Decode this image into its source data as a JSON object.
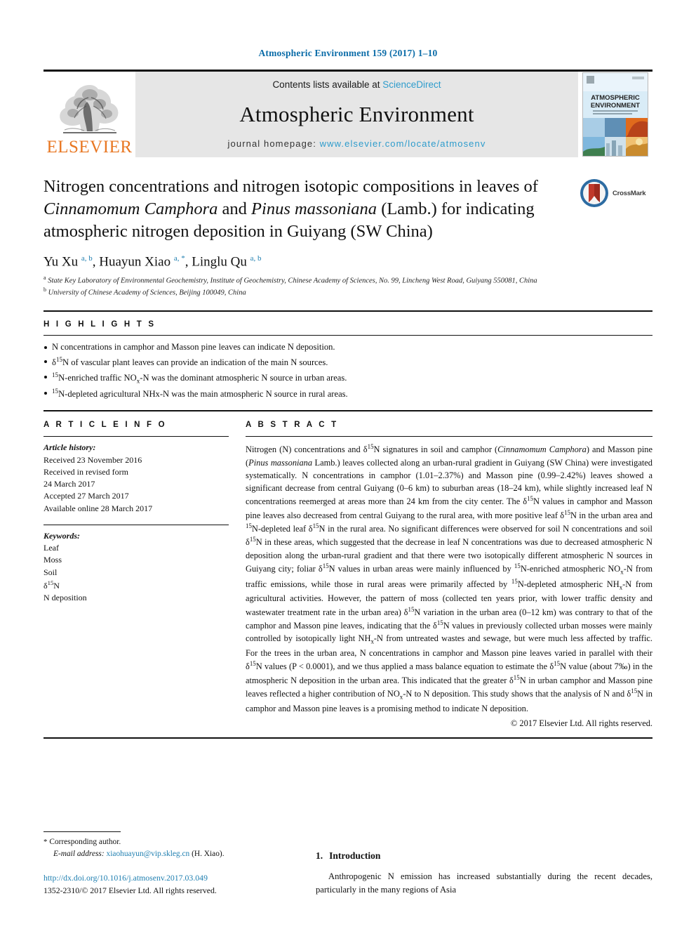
{
  "running_head": "Atmospheric Environment 159 (2017) 1–10",
  "banner": {
    "publisher_name": "ELSEVIER",
    "contents_prefix": "Contents lists available at ",
    "sciencedirect": "ScienceDirect",
    "journal_title": "Atmospheric Environment",
    "homepage_label": "journal homepage: ",
    "homepage_url": "www.elsevier.com/locate/atmosenv",
    "cover_title_line1": "ATMOSPHERIC",
    "cover_title_line2": "ENVIRONMENT"
  },
  "article": {
    "title_part1": "Nitrogen concentrations and nitrogen isotopic compositions in leaves of ",
    "title_italic1": "Cinnamomum Camphora",
    "title_part2": " and ",
    "title_italic2": "Pinus massoniana",
    "title_part3": " (Lamb.) for indicating atmospheric nitrogen deposition in Guiyang (SW China)",
    "crossmark_label": "CrossMark",
    "authors_plain": "Yu Xu a, b, Huayun Xiao a, *, Linglu Qu a, b",
    "affiliation_a": "State Key Laboratory of Environmental Geochemistry, Institute of Geochemistry, Chinese Academy of Sciences, No. 99, Lincheng West Road, Guiyang 550081, China",
    "affiliation_b": "University of Chinese Academy of Sciences, Beijing 100049, China"
  },
  "highlights": {
    "heading": "H I G H L I G H T S",
    "items": [
      "N concentrations in camphor and Masson pine leaves can indicate N deposition.",
      "δ15N of vascular plant leaves can provide an indication of the main N sources.",
      "15N-enriched traffic NOx-N was the dominant atmospheric N source in urban areas.",
      "15N-depleted agricultural NHx-N was the main atmospheric N source in rural areas."
    ]
  },
  "article_info": {
    "heading": "A R T I C L E   I N F O",
    "history_label": "Article history:",
    "history": [
      "Received 23 November 2016",
      "Received in revised form",
      "24 March 2017",
      "Accepted 27 March 2017",
      "Available online 28 March 2017"
    ],
    "keywords_label": "Keywords:",
    "keywords": [
      "Leaf",
      "Moss",
      "Soil",
      "δ15N",
      "N deposition"
    ]
  },
  "abstract": {
    "heading": "A B S T R A C T",
    "text": "Nitrogen (N) concentrations and δ15N signatures in soil and camphor (Cinnamomum Camphora) and Masson pine (Pinus massoniana Lamb.) leaves collected along an urban-rural gradient in Guiyang (SW China) were investigated systematically. N concentrations in camphor (1.01–2.37%) and Masson pine (0.99–2.42%) leaves showed a significant decrease from central Guiyang (0–6 km) to suburban areas (18–24 km), while slightly increased leaf N concentrations reemerged at areas more than 24 km from the city center. The δ15N values in camphor and Masson pine leaves also decreased from central Guiyang to the rural area, with more positive leaf δ15N in the urban area and 15N-depleted leaf δ15N in the rural area. No significant differences were observed for soil N concentrations and soil δ15N in these areas, which suggested that the decrease in leaf N concentrations was due to decreased atmospheric N deposition along the urban-rural gradient and that there were two isotopically different atmospheric N sources in Guiyang city; foliar δ15N values in urban areas were mainly influenced by 15N-enriched atmospheric NOx-N from traffic emissions, while those in rural areas were primarily affected by 15N-depleted atmospheric NHx-N from agricultural activities. However, the pattern of moss (collected ten years prior, with lower traffic density and wastewater treatment rate in the urban area) δ15N variation in the urban area (0–12 km) was contrary to that of the camphor and Masson pine leaves, indicating that the δ15N values in previously collected urban mosses were mainly controlled by isotopically light NHx-N from untreated wastes and sewage, but were much less affected by traffic. For the trees in the urban area, N concentrations in camphor and Masson pine leaves varied in parallel with their δ15N values (P < 0.0001), and we thus applied a mass balance equation to estimate the δ15N value (about 7‰) in the atmospheric N deposition in the urban area. This indicated that the greater δ15N in urban camphor and Masson pine leaves reflected a higher contribution of NOx-N to N deposition. This study shows that the analysis of N and δ15N in camphor and Masson pine leaves is a promising method to indicate N deposition.",
    "copyright": "© 2017 Elsevier Ltd. All rights reserved."
  },
  "footer": {
    "corresponding_label": "Corresponding author.",
    "email_label": "E-mail address:",
    "email": "xiaohuayun@vip.skleg.cn",
    "email_owner": "(H. Xiao).",
    "doi_url": "http://dx.doi.org/10.1016/j.atmosenv.2017.03.049",
    "issn_line": "1352-2310/© 2017 Elsevier Ltd. All rights reserved."
  },
  "introduction": {
    "number": "1.",
    "heading": "Introduction",
    "paragraph": "Anthropogenic N emission has increased substantially during the recent decades, particularly in the many regions of Asia"
  },
  "colors": {
    "link_blue": "#1f7fb0",
    "sciencedirect_blue": "#2e9ccc",
    "elsevier_orange": "#E87722",
    "banner_gray": "#e6e6e6"
  }
}
